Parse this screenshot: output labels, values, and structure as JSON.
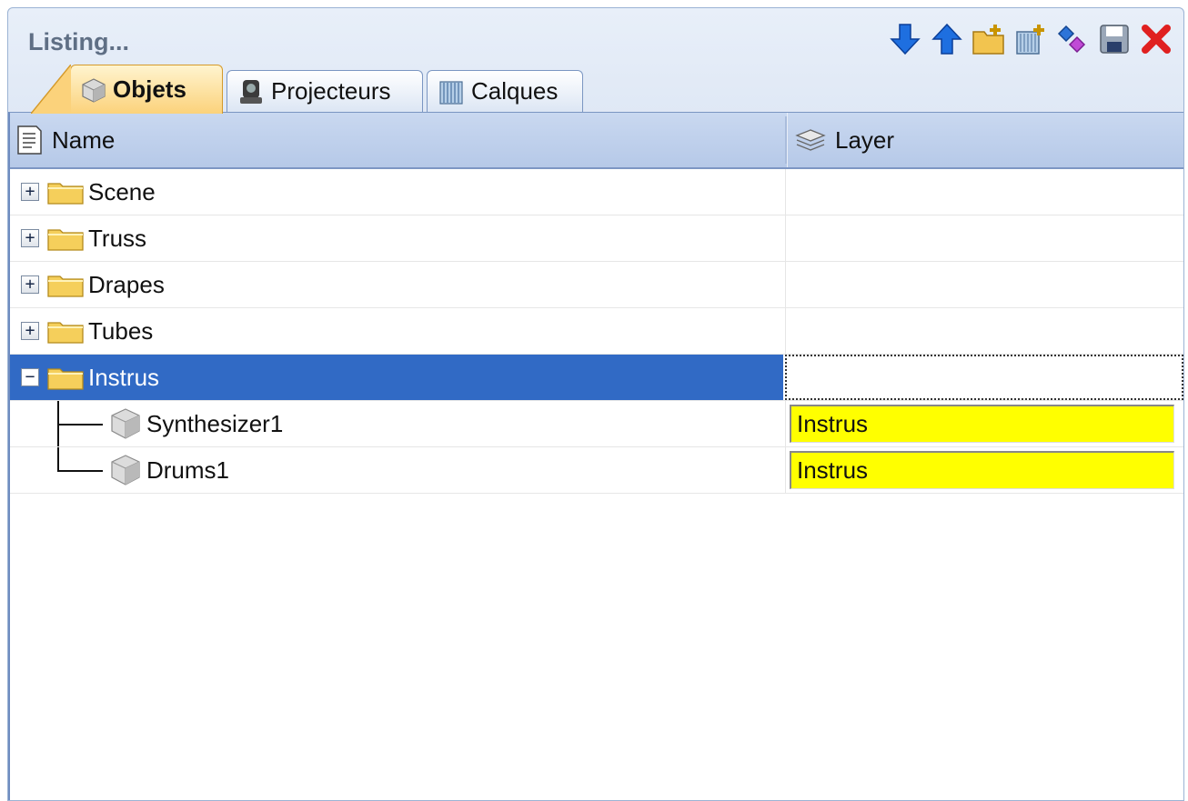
{
  "panel": {
    "title": "Listing..."
  },
  "toolbar": {
    "buttons": [
      {
        "icon": "arrow-down-icon"
      },
      {
        "icon": "arrow-up-icon"
      },
      {
        "icon": "new-folder-icon"
      },
      {
        "icon": "new-layer-icon"
      },
      {
        "icon": "assign-icon"
      },
      {
        "icon": "save-icon"
      },
      {
        "icon": "close-icon"
      }
    ]
  },
  "tabs": [
    {
      "label": "Objets",
      "icon": "cube-icon",
      "active": true
    },
    {
      "label": "Projecteurs",
      "icon": "projector-icon",
      "active": false
    },
    {
      "label": "Calques",
      "icon": "layers-icon",
      "active": false
    }
  ],
  "columns": {
    "name": "Name",
    "layer": "Layer"
  },
  "rows": [
    {
      "name": "Scene",
      "expander": "+",
      "layer": ""
    },
    {
      "name": "Truss",
      "expander": "+",
      "layer": ""
    },
    {
      "name": "Drapes",
      "expander": "+",
      "layer": ""
    },
    {
      "name": "Tubes",
      "expander": "+",
      "layer": ""
    },
    {
      "name": "Instrus",
      "expander": "−",
      "layer": "",
      "selected": true
    },
    {
      "name": "Synthesizer1",
      "layer": "Instrus",
      "child": true
    },
    {
      "name": "Drums1",
      "layer": "Instrus",
      "child": true
    }
  ],
  "colors": {
    "selection": "#316ac5",
    "layer_highlight": "#ffff00",
    "header": "#b6c9e8",
    "active_tab": "#fbd27b"
  }
}
